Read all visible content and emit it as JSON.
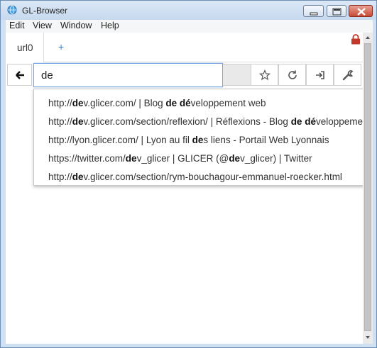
{
  "window": {
    "title": "GL-Browser"
  },
  "menu": {
    "items": [
      "Edit",
      "View",
      "Window",
      "Help"
    ]
  },
  "tabs": {
    "items": [
      {
        "label": "url0"
      }
    ],
    "add_label": "+"
  },
  "nav": {
    "url_value": "de"
  },
  "suggestions": [
    [
      {
        "t": "http://"
      },
      {
        "t": "de",
        "b": true
      },
      {
        "t": "v.glicer.com/ | Blog "
      },
      {
        "t": "de",
        "b": true
      },
      {
        "t": " "
      },
      {
        "t": "dé",
        "b": true
      },
      {
        "t": "veloppement web"
      }
    ],
    [
      {
        "t": "http://"
      },
      {
        "t": "de",
        "b": true
      },
      {
        "t": "v.glicer.com/section/reflexion/ | Réflexions - Blog "
      },
      {
        "t": "de",
        "b": true
      },
      {
        "t": " "
      },
      {
        "t": "dé",
        "b": true
      },
      {
        "t": "veloppement web"
      }
    ],
    [
      {
        "t": "http://lyon.glicer.com/ | Lyon au fil "
      },
      {
        "t": "de",
        "b": true
      },
      {
        "t": "s liens - Portail Web Lyonnais"
      }
    ],
    [
      {
        "t": "https://twitter.com/"
      },
      {
        "t": "de",
        "b": true
      },
      {
        "t": "v_glicer | GLICER (@"
      },
      {
        "t": "de",
        "b": true
      },
      {
        "t": "v_glicer) | Twitter"
      }
    ],
    [
      {
        "t": "http://"
      },
      {
        "t": "de",
        "b": true
      },
      {
        "t": "v.glicer.com/section/rym-bouchagour-emmanuel-roecker.html"
      }
    ]
  ],
  "icons": {
    "app": "globe-icon",
    "back": "arrow-left-icon",
    "bookmark": "star-icon",
    "reload": "reload-icon",
    "login": "sign-in-icon",
    "settings": "wrench-icon",
    "lock": "lock-icon"
  },
  "colors": {
    "accent": "#3b7fd0",
    "lock": "#c0392b",
    "input_border": "#78a7e0"
  }
}
